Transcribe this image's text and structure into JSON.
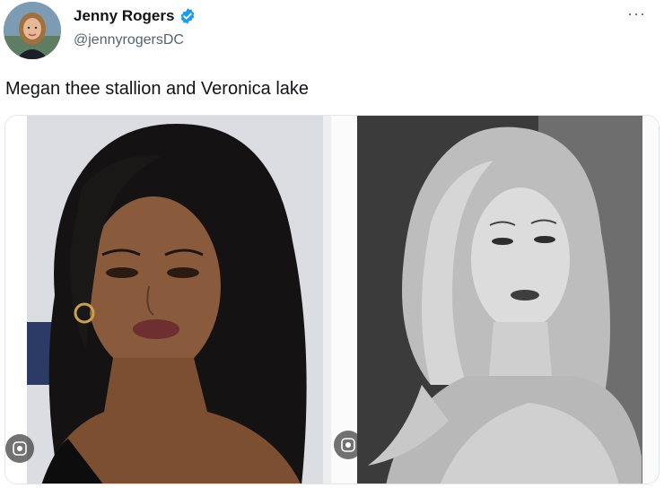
{
  "post": {
    "author_name": "Jenny Rogers",
    "handle": "@jennyrogersDC",
    "more_label": "···",
    "text": "Megan thee stallion and Veronica lake"
  },
  "icons": {
    "verified": "verified-badge-icon",
    "more": "more-options-icon",
    "image_search": "image-search-lens-icon"
  },
  "colors": {
    "verified_blue": "#1d9bf0",
    "text_primary": "#0f1419",
    "text_secondary": "#536471"
  },
  "media": {
    "images": [
      {
        "alt": "photo-left"
      },
      {
        "alt": "photo-right"
      }
    ]
  }
}
